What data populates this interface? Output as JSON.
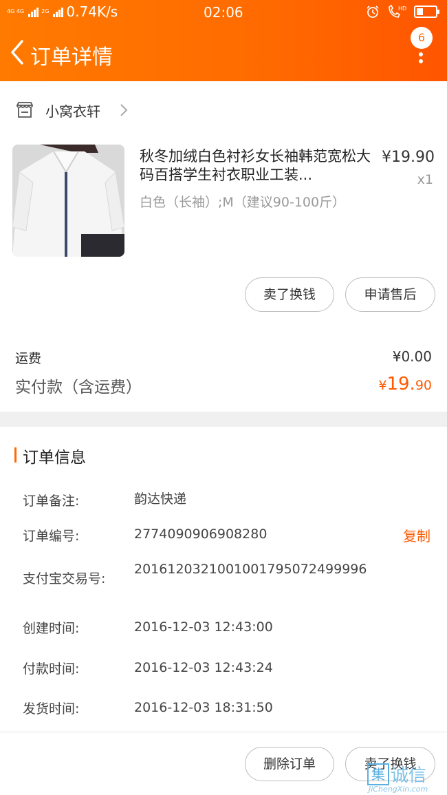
{
  "status_bar": {
    "network_left": "4G 4G",
    "network_mid": "2G",
    "speed": "0.74K/s",
    "time": "02:06",
    "hd": "HD"
  },
  "nav": {
    "title": "订单详情",
    "badge_count": "6"
  },
  "shop": {
    "name": "小窝衣轩"
  },
  "product": {
    "title": "秋冬加绒白色衬衫女长袖韩范宽松大码百搭学生衬衣职业工装...",
    "price": "¥19.90",
    "quantity": "x1",
    "sku": "白色（长袖）;M（建议90-100斤）",
    "actions": {
      "sell": "卖了换钱",
      "after_sale": "申请售后"
    }
  },
  "summary": {
    "shipping_label": "运费",
    "shipping_value": "¥0.00",
    "total_label": "实付款（含运费）",
    "total_currency": "¥",
    "total_int": "19.",
    "total_dec": "90"
  },
  "order_info": {
    "title": "订单信息",
    "copy_label": "复制",
    "rows": [
      {
        "label": "订单备注:",
        "value": "韵达快递"
      },
      {
        "label": "订单编号:",
        "value": "2774090906908280"
      },
      {
        "label": "支付宝交易号:",
        "value": "2016120321001001795072499996"
      },
      {
        "label": "创建时间:",
        "value": "2016-12-03 12:43:00"
      },
      {
        "label": "付款时间:",
        "value": "2016-12-03 12:43:24"
      },
      {
        "label": "发货时间:",
        "value": "2016-12-03 18:31:50"
      }
    ]
  },
  "footer": {
    "delete": "删除订单",
    "sell": "卖了换钱"
  },
  "watermark": {
    "box_char": "集",
    "text": "诚信",
    "sub": "JiChengXin.com"
  },
  "colors": {
    "header": "#ff6a00",
    "accent": "#ff5a00"
  }
}
